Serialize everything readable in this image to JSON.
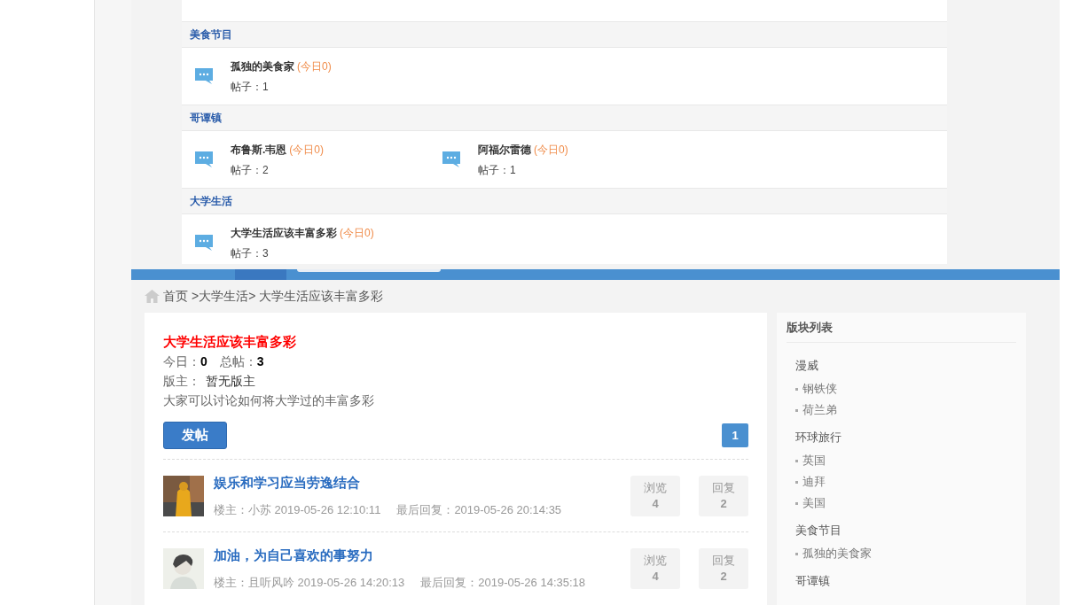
{
  "forum_sections": [
    {
      "title": "美食节目",
      "forums": [
        {
          "name": "孤独的美食家",
          "today": "(今日0)",
          "posts": "帖子：1"
        }
      ]
    },
    {
      "title": "哥谭镇",
      "forums": [
        {
          "name": "布鲁斯.韦恩",
          "today": "(今日0)",
          "posts": "帖子：2"
        },
        {
          "name": "阿福尔雷德",
          "today": "(今日0)",
          "posts": "帖子：1"
        }
      ]
    },
    {
      "title": "大学生活",
      "forums": [
        {
          "name": "大学生活应该丰富多彩",
          "today": "(今日0)",
          "posts": "帖子：3"
        }
      ]
    }
  ],
  "breadcrumb": [
    "首页",
    ">大学生活>",
    "大学生活应该丰富多彩"
  ],
  "board": {
    "title": "大学生活应该丰富多彩",
    "today_label": "今日：",
    "today": "0",
    "total_label": "总帖：",
    "total": "3",
    "moderator_label": "版主：",
    "moderator": "暂无版主",
    "description": "大家可以讨论如何将大学过的丰富多彩",
    "post_button": "发帖",
    "pages": [
      {
        "label": "1",
        "selected": true
      }
    ]
  },
  "threads": [
    {
      "title": "娱乐和学习应当劳逸结合",
      "author": "楼主：小苏 2019-05-26 12:10:11",
      "last_reply": "最后回复：2019-05-26 20:14:35",
      "views_label": "浏览",
      "views": "4",
      "replies_label": "回复",
      "replies": "2"
    },
    {
      "title": "加油，为自己喜欢的事努力",
      "author": "楼主：且听风吟 2019-05-26 14:20:13",
      "last_reply": "最后回复：2019-05-26 14:35:18",
      "views_label": "浏览",
      "views": "4",
      "replies_label": "回复",
      "replies": "2"
    }
  ],
  "sidebar": {
    "title": "版块列表",
    "groups": [
      {
        "name": "漫威",
        "items": [
          "钢铁侠",
          "荷兰弟"
        ]
      },
      {
        "name": "环球旅行",
        "items": [
          "英国",
          "迪拜",
          "美国"
        ]
      },
      {
        "name": "美食节目",
        "items": [
          "孤独的美食家"
        ]
      },
      {
        "name": "哥谭镇"
      }
    ]
  }
}
